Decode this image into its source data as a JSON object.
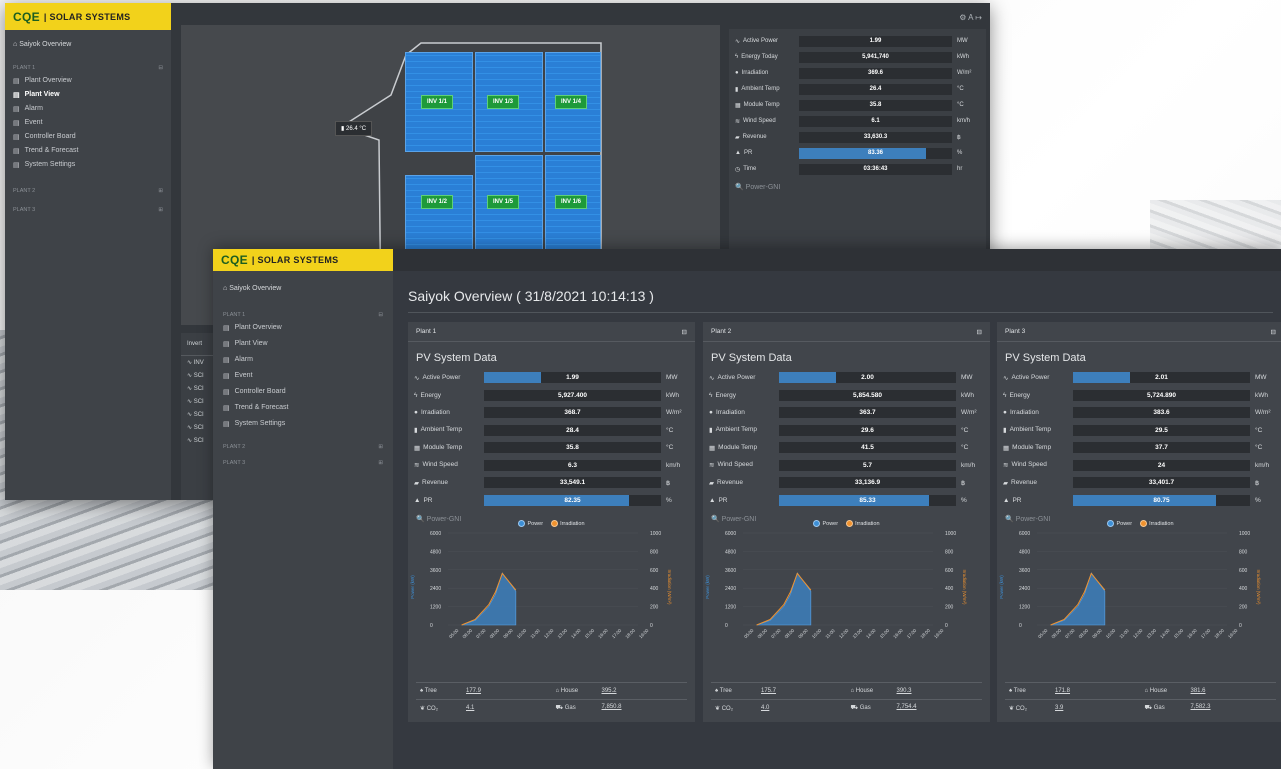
{
  "brand": {
    "mark": "CQE",
    "name": "| SOLAR SYSTEMS"
  },
  "back": {
    "nav": {
      "overview": "Saiyok Overview",
      "plant1": "PLANT 1",
      "items": [
        "Plant Overview",
        "Plant View",
        "Alarm",
        "Event",
        "Controller Board",
        "Trend & Forecast",
        "System Settings"
      ],
      "plant2": "PLANT 2",
      "plant3": "PLANT 3"
    },
    "temp_tag": "26.4 °C",
    "inverters": [
      "INV 1/1",
      "INV 1/3",
      "INV 1/4",
      "INV 1/2",
      "INV 1/5",
      "INV 1/6"
    ],
    "data": [
      {
        "label": "Active Power",
        "value": "1.99",
        "unit": "MW"
      },
      {
        "label": "Energy Today",
        "value": "5,941,740",
        "unit": "kWh"
      },
      {
        "label": "Irradiation",
        "value": "369.6",
        "unit": "W/m²"
      },
      {
        "label": "Ambient Temp",
        "value": "26.4",
        "unit": "°C"
      },
      {
        "label": "Module Temp",
        "value": "35.8",
        "unit": "°C"
      },
      {
        "label": "Wind Speed",
        "value": "6.1",
        "unit": "km/h"
      },
      {
        "label": "Revenue",
        "value": "33,630.3",
        "unit": "฿"
      },
      {
        "label": "PR",
        "value": "83.36",
        "unit": "%"
      },
      {
        "label": "Time",
        "value": "03:36:43",
        "unit": "hr"
      }
    ],
    "power_gni": "Power-GNI",
    "lower_header": "Invert",
    "lower_rows": [
      "INV",
      "SCI",
      "SCI",
      "SCI",
      "SCI",
      "SCI",
      "SCI"
    ]
  },
  "front": {
    "nav": {
      "overview": "Saiyok Overview",
      "plant1": "PLANT 1",
      "items": [
        "Plant Overview",
        "Plant View",
        "Alarm",
        "Event",
        "Controller Board",
        "Trend & Forecast",
        "System Settings"
      ],
      "plant2": "PLANT 2",
      "plant3": "PLANT 3"
    },
    "page_title": "Saiyok Overview ( 31/8/2021 10:14:13 )",
    "labels": {
      "pv": "PV System Data",
      "power_gni": "Power-GNI",
      "legend_power": "Power",
      "legend_irr": "Irradiation",
      "tree": "Tree",
      "house": "House",
      "co2": "CO₂",
      "gas": "Gas",
      "y_left": "Power (kW)",
      "y_right": "Irradiation (W/m²)"
    },
    "plants": [
      {
        "name": "Plant 1",
        "rows": [
          {
            "label": "Active Power",
            "value": "1.99",
            "unit": "MW"
          },
          {
            "label": "Energy",
            "value": "5,927.400",
            "unit": "kWh"
          },
          {
            "label": "Irradiation",
            "value": "368.7",
            "unit": "W/m²"
          },
          {
            "label": "Ambient Temp",
            "value": "28.4",
            "unit": "°C"
          },
          {
            "label": "Module Temp",
            "value": "35.8",
            "unit": "°C"
          },
          {
            "label": "Wind Speed",
            "value": "6.3",
            "unit": "km/h"
          },
          {
            "label": "Revenue",
            "value": "33,549.1",
            "unit": "฿"
          },
          {
            "label": "PR",
            "value": "82.35",
            "unit": "%"
          }
        ],
        "footer": {
          "tree": "177.9",
          "house": "395.2",
          "co2": "4.1",
          "gas": "7,850.8"
        }
      },
      {
        "name": "Plant 2",
        "rows": [
          {
            "label": "Active Power",
            "value": "2.00",
            "unit": "MW"
          },
          {
            "label": "Energy",
            "value": "5,854.580",
            "unit": "kWh"
          },
          {
            "label": "Irradiation",
            "value": "363.7",
            "unit": "W/m²"
          },
          {
            "label": "Ambient Temp",
            "value": "29.6",
            "unit": "°C"
          },
          {
            "label": "Module Temp",
            "value": "41.5",
            "unit": "°C"
          },
          {
            "label": "Wind Speed",
            "value": "5.7",
            "unit": "km/h"
          },
          {
            "label": "Revenue",
            "value": "33,136.9",
            "unit": "฿"
          },
          {
            "label": "PR",
            "value": "85.33",
            "unit": "%"
          }
        ],
        "footer": {
          "tree": "175.7",
          "house": "390.3",
          "co2": "4.0",
          "gas": "7,754.4"
        }
      },
      {
        "name": "Plant 3",
        "rows": [
          {
            "label": "Active Power",
            "value": "2.01",
            "unit": "MW"
          },
          {
            "label": "Energy",
            "value": "5,724.890",
            "unit": "kWh"
          },
          {
            "label": "Irradiation",
            "value": "383.6",
            "unit": "W/m²"
          },
          {
            "label": "Ambient Temp",
            "value": "29.5",
            "unit": "°C"
          },
          {
            "label": "Module Temp",
            "value": "37.7",
            "unit": "°C"
          },
          {
            "label": "Wind Speed",
            "value": "24",
            "unit": "km/h"
          },
          {
            "label": "Revenue",
            "value": "33,401.7",
            "unit": "฿"
          },
          {
            "label": "PR",
            "value": "80.75",
            "unit": "%"
          }
        ],
        "footer": {
          "tree": "171.8",
          "house": "381.6",
          "co2": "3.9",
          "gas": "7,582.3"
        }
      }
    ],
    "chart": {
      "y_ticks": [
        "6000",
        "4800",
        "3600",
        "2400",
        "1200",
        "0"
      ],
      "y2_ticks": [
        "1000",
        "800",
        "600",
        "400",
        "200",
        "0"
      ],
      "x_ticks": [
        "05:00",
        "06:00",
        "07:00",
        "08:00",
        "09:00",
        "10:00",
        "11:00",
        "12:00",
        "13:00",
        "14:00",
        "15:00",
        "16:00",
        "17:00",
        "18:00",
        "19:00"
      ]
    }
  },
  "chart_data": [
    {
      "type": "area",
      "x": [
        "06:00",
        "07:00",
        "08:00",
        "08:30",
        "09:00",
        "09:30",
        "10:00"
      ],
      "series": [
        {
          "name": "Power",
          "values": [
            0,
            300,
            1200,
            2000,
            3400,
            2800,
            2200
          ]
        },
        {
          "name": "Irradiation",
          "values": [
            0,
            60,
            220,
            360,
            560,
            470,
            380
          ]
        }
      ],
      "ylim": [
        0,
        6000
      ],
      "y2lim": [
        0,
        1000
      ]
    }
  ],
  "colors": {
    "accent": "#f2d21b",
    "power": "#3d8fd6",
    "irradiation": "#f0922e",
    "bar": "#3d7fbc"
  }
}
